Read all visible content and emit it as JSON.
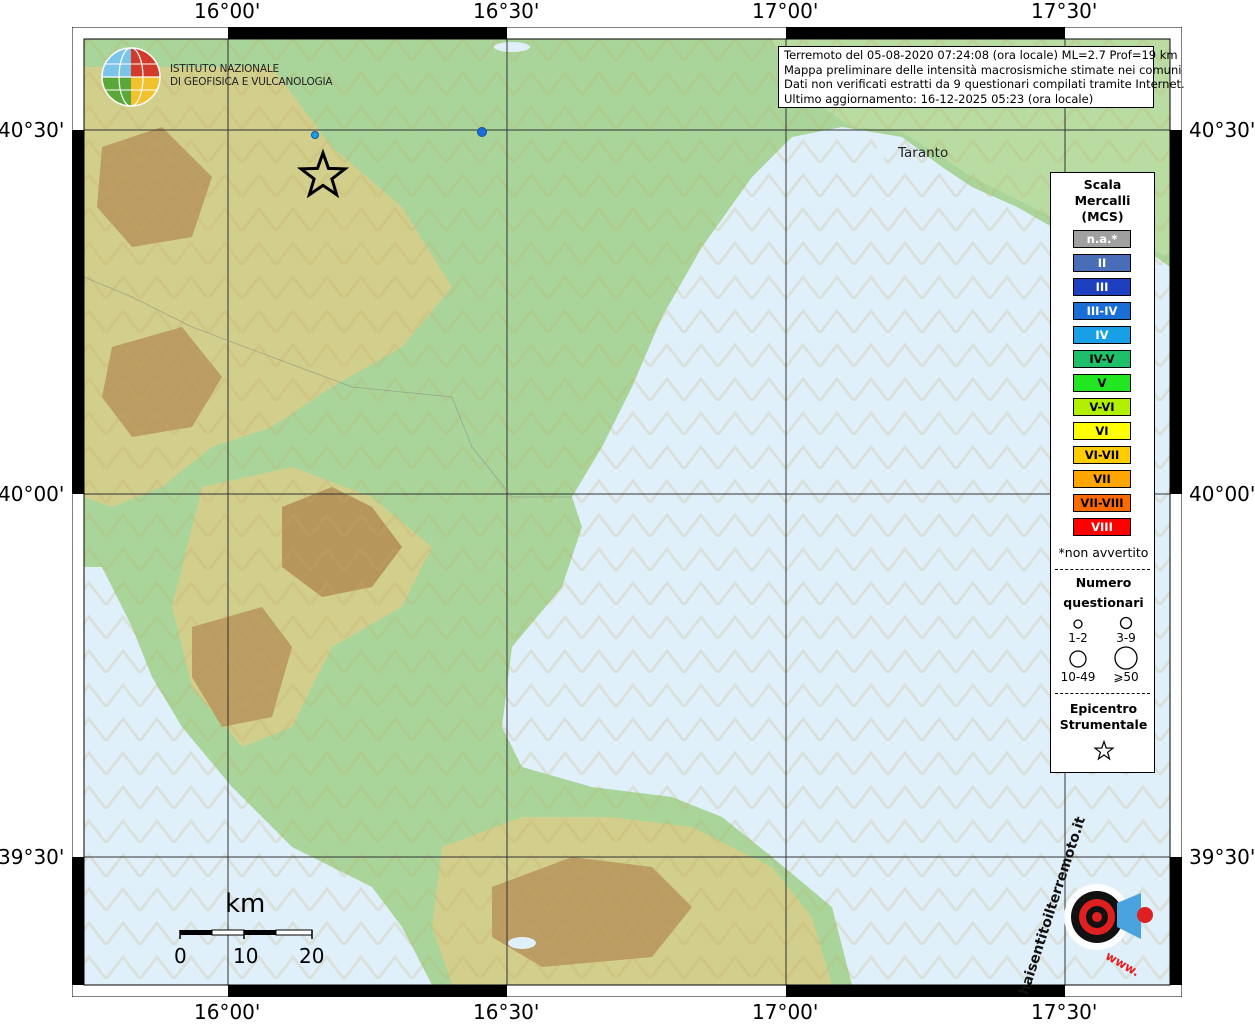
{
  "map": {
    "lon_ticks": [
      "16°00'",
      "16°30'",
      "17°00'",
      "17°30'"
    ],
    "lat_ticks": [
      "40°30'",
      "40°00'",
      "39°30'"
    ],
    "place_labels": [
      "Taranto"
    ],
    "colors": {
      "sea": "#e0f0fb",
      "lowland": "#a9d59a",
      "hills": "#d9cc8a",
      "mountains": "#b08850"
    }
  },
  "info": {
    "lines": [
      "Terremoto del 05-08-2020 07:24:08 (ora locale) ML=2.7 Prof=19 km",
      "Mappa preliminare delle intensità macrosismiche stimate nei comuni",
      "Dati non verificati estratti da 9 questionari compilati tramite Internet.",
      "Ultimo aggiornamento: 16-12-2025 05:23 (ora locale)"
    ]
  },
  "logo": {
    "line1": "ISTITUTO NAZIONALE",
    "line2": "DI GEOFISICA E VULCANOLOGIA"
  },
  "legend": {
    "title": "Scala Mercalli (MCS)",
    "title_lines": [
      "Scala",
      "Mercalli",
      "(MCS)"
    ],
    "classes": [
      {
        "label": "n.a.*",
        "color": "#a0a0a0",
        "text": "#ffffff"
      },
      {
        "label": "II",
        "color": "#4a6db8",
        "text": "#ffffff"
      },
      {
        "label": "III",
        "color": "#1e3fbf",
        "text": "#ffffff"
      },
      {
        "label": "III-IV",
        "color": "#1a6fd6",
        "text": "#ffffff"
      },
      {
        "label": "IV",
        "color": "#18a0e6",
        "text": "#ffffff"
      },
      {
        "label": "IV-V",
        "color": "#1fbf6a",
        "text": "#000000"
      },
      {
        "label": "V",
        "color": "#22e622",
        "text": "#000000"
      },
      {
        "label": "V-VI",
        "color": "#b0f000",
        "text": "#000000"
      },
      {
        "label": "VI",
        "color": "#ffff00",
        "text": "#000000"
      },
      {
        "label": "VI-VII",
        "color": "#ffcc00",
        "text": "#000000"
      },
      {
        "label": "VII",
        "color": "#ffa500",
        "text": "#000000"
      },
      {
        "label": "VII-VIII",
        "color": "#ff6a00",
        "text": "#000000"
      },
      {
        "label": "VIII",
        "color": "#ff0000",
        "text": "#ffffff"
      }
    ],
    "note": "*non avvertito",
    "count_title_1": "Numero",
    "count_title_2": "questionari",
    "count_labels": [
      "1-2",
      "3-9",
      "10-49",
      "⩾50"
    ],
    "epicenter_title_1": "Epicentro",
    "epicenter_title_2": "Strumentale"
  },
  "scale_bar": {
    "unit": "km",
    "labels": [
      "0",
      "10",
      "20"
    ]
  },
  "badge": {
    "text": "haisentitoilterremoto.it",
    "url_text": "www."
  },
  "observations": [
    {
      "intensity": "IV",
      "count": "1-2"
    },
    {
      "intensity": "IV",
      "count": "1-2"
    }
  ]
}
